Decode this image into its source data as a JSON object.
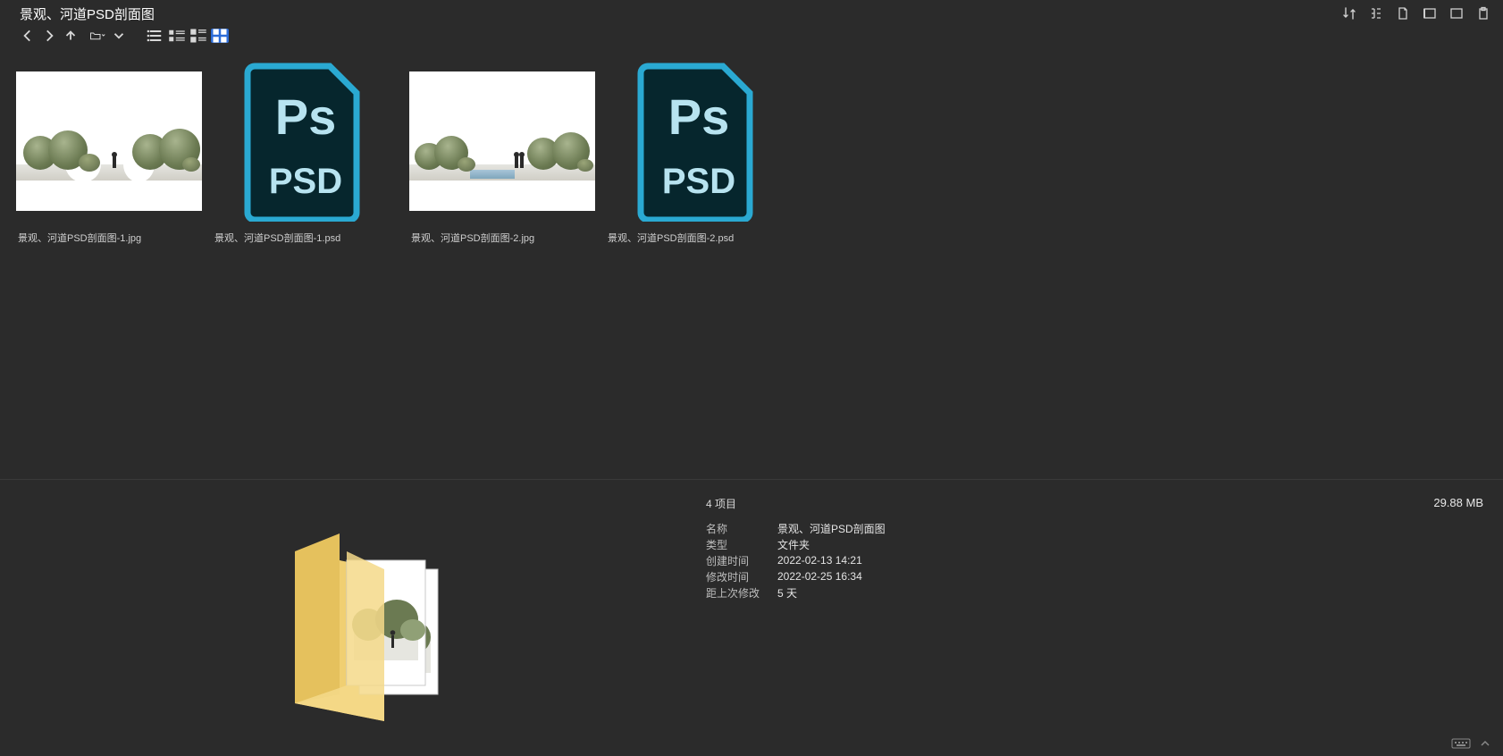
{
  "title": "景观、河道PSD剖面图",
  "files": [
    {
      "name": "景观、河道PSD剖面图-1.jpg",
      "type": "jpg",
      "variant": 1
    },
    {
      "name": "景观、河道PSD剖面图-1.psd",
      "type": "psd"
    },
    {
      "name": "景观、河道PSD剖面图-2.jpg",
      "type": "jpg",
      "variant": 2
    },
    {
      "name": "景观、河道PSD剖面图-2.psd",
      "type": "psd"
    }
  ],
  "psd_label_top": "Ps",
  "psd_label_bottom": "PSD",
  "footer": {
    "item_count": "4 项目",
    "total_size": "29.88 MB",
    "props": {
      "name_label": "名称",
      "name_value": "景观、河道PSD剖面图",
      "type_label": "类型",
      "type_value": "文件夹",
      "created_label": "创建时间",
      "created_value": "2022-02-13  14:21",
      "modified_label": "修改时间",
      "modified_value": "2022-02-25  16:34",
      "since_label": "距上次修改",
      "since_value": "5 天"
    }
  }
}
